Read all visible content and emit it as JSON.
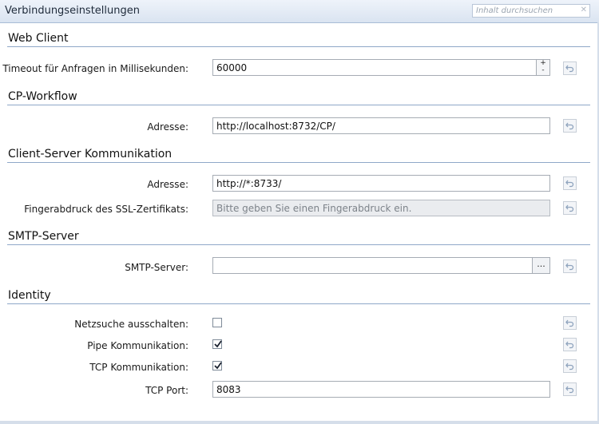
{
  "window": {
    "title": "Verbindungseinstellungen"
  },
  "search": {
    "placeholder": "Inhalt durchsuchen",
    "clear_icon": "close-icon"
  },
  "sections": {
    "web_client": {
      "title": "Web Client",
      "timeout_label": "Timeout für Anfragen in Millisekunden:",
      "timeout_value": "60000",
      "spin_up": "+",
      "spin_down": "-"
    },
    "cp_workflow": {
      "title": "CP-Workflow",
      "address_label": "Adresse:",
      "address_value": "http://localhost:8732/CP/"
    },
    "client_server": {
      "title": "Client-Server Kommunikation",
      "address_label": "Adresse:",
      "address_value": "http://*:8733/",
      "fingerprint_label": "Fingerabdruck des SSL-Zertifikats:",
      "fingerprint_placeholder": "Bitte geben Sie einen Fingerabdruck ein."
    },
    "smtp": {
      "title": "SMTP-Server",
      "server_label": "SMTP-Server:",
      "server_value": "",
      "browse_label": "..."
    },
    "identity": {
      "title": "Identity",
      "netsearch_label": "Netzsuche ausschalten:",
      "netsearch_checked": false,
      "pipe_label": "Pipe Kommunikation:",
      "pipe_checked": true,
      "tcp_label": "TCP Kommunikation:",
      "tcp_checked": true,
      "tcp_port_label": "TCP Port:",
      "tcp_port_value": "8083"
    }
  },
  "colors": {
    "accent_line": "#8fa8c8",
    "titlebar": "#dae4f1"
  }
}
